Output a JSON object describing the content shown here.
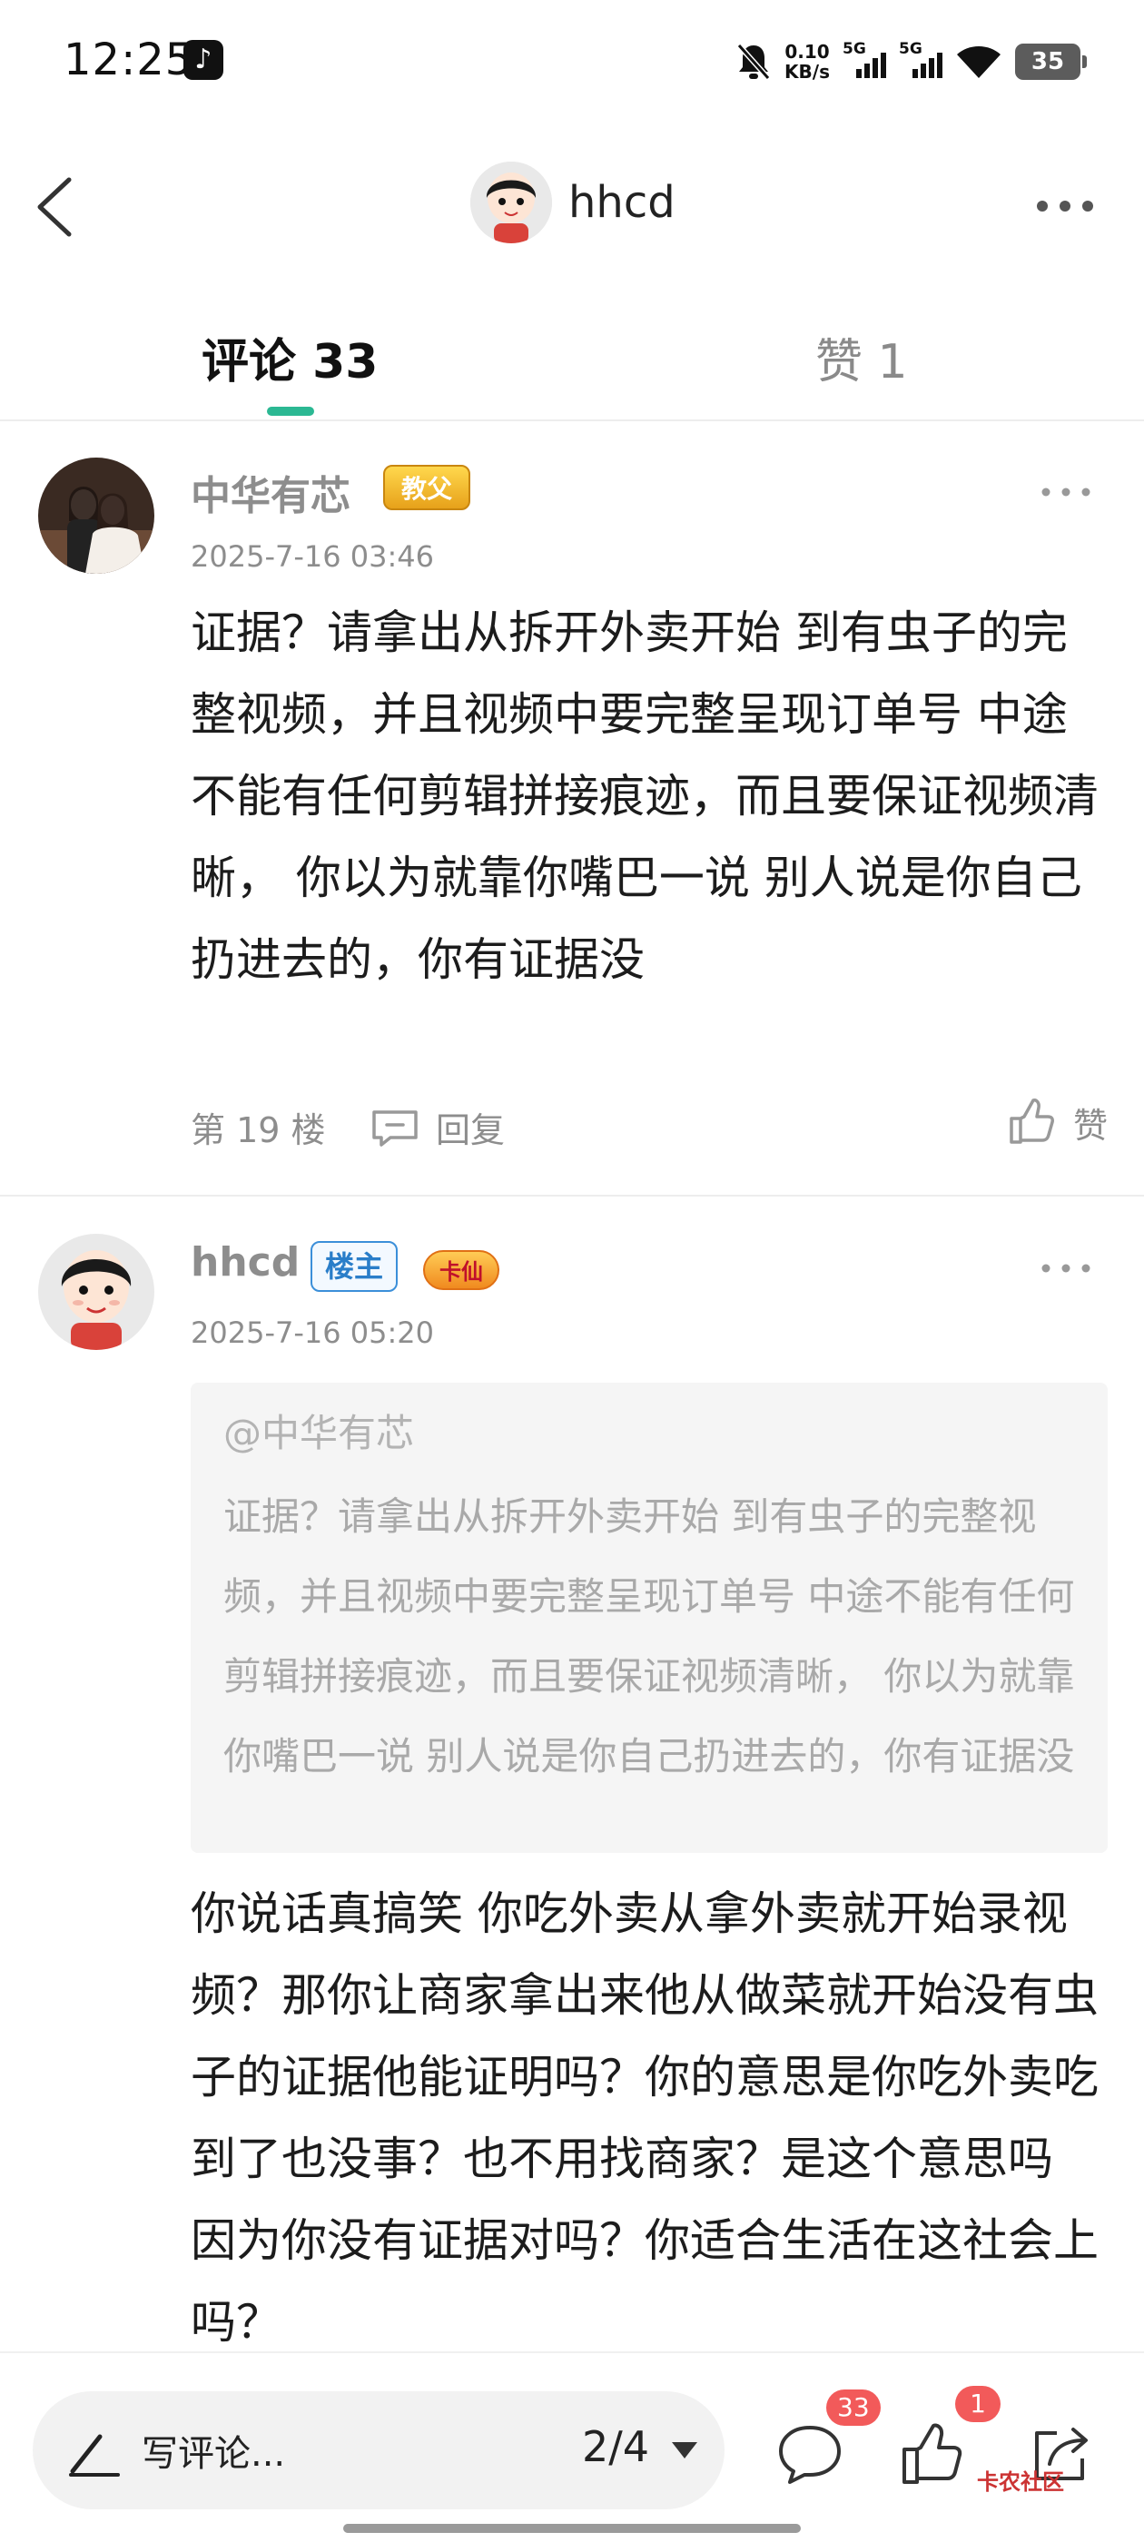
{
  "status_bar": {
    "time": "12:25",
    "net_speed_value": "0.10",
    "net_speed_unit": "KB/s",
    "signal_1_label": "5G",
    "signal_2_label": "5G",
    "battery": "35"
  },
  "header": {
    "title": "hhcd"
  },
  "tabs": {
    "comments": "评论 33",
    "likes": "赞 1"
  },
  "comments": [
    {
      "username": "中华有芯",
      "badge": "教父",
      "time": "2025-7-16 03:46",
      "body": "证据？请拿出从拆开外卖开始 到有虫子的完整视频，并且视频中要完整呈现订单号 中途不能有任何剪辑拼接痕迹，而且要保证视频清晰， 你以为就靠你嘴巴一说 别人说是你自己扔进去的，你有证据没",
      "floor": "第 19 楼",
      "reply_label": "回复",
      "like_label": "赞"
    },
    {
      "username": "hhcd",
      "op_badge": "楼主",
      "badge": "卡仙",
      "time": "2025-7-16 05:20",
      "quote_user": "@中华有芯",
      "quote_text": "证据？请拿出从拆开外卖开始 到有虫子的完整视频，并且视频中要完整呈现订单号 中途不能有任何剪辑拼接痕迹，而且要保证视频清晰， 你以为就靠你嘴巴一说 别人说是你自己扔进去的，你有证据没",
      "body": "你说话真搞笑  你吃外卖从拿外卖就开始录视频？那你让商家拿出来他从做菜就开始没有虫子的证据他能证明吗？你的意思是你吃外卖吃到了也没事？也不用找商家？是这个意思吗  因为你没有证据对吗？你适合生活在这社会上吗？"
    }
  ],
  "bottom_bar": {
    "write_placeholder": "写评论...",
    "page": "2/4",
    "comment_count": "33",
    "like_count": "1",
    "watermark": "卡农社区"
  },
  "colors": {
    "accent": "#2bb893",
    "badge_red": "#f25a5a",
    "muted_text": "#8d8d8d"
  },
  "icons": [
    "back-icon",
    "more-icon",
    "reply-icon",
    "thumbs-up-icon",
    "pencil-icon",
    "caret-down-icon",
    "comment-icon",
    "share-icon",
    "mute-icon",
    "wifi-icon",
    "tiktok-icon"
  ]
}
